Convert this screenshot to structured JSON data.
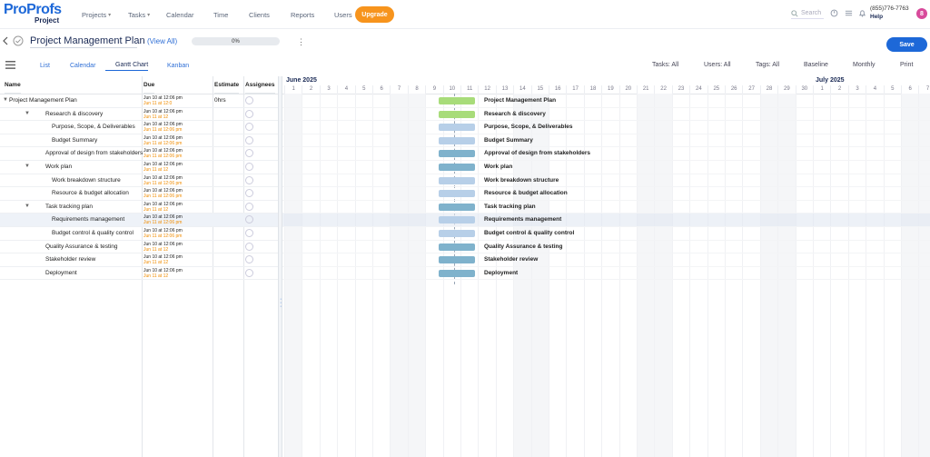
{
  "brand": {
    "name": "ProProfs",
    "product": "Project"
  },
  "nav": [
    {
      "label": "Projects",
      "icon": "folder-icon",
      "has_caret": true
    },
    {
      "label": "Tasks",
      "icon": "check-circle-icon",
      "has_caret": true
    },
    {
      "label": "Calendar",
      "icon": "calendar-icon",
      "has_caret": false
    },
    {
      "label": "Time",
      "icon": "clock-icon",
      "has_caret": false
    },
    {
      "label": "Clients",
      "icon": "client-icon",
      "has_caret": false
    },
    {
      "label": "Reports",
      "icon": "bar-chart-icon",
      "has_caret": false
    },
    {
      "label": "Users",
      "icon": "user-icon",
      "has_caret": false
    }
  ],
  "upgrade_label": "Upgrade",
  "search_placeholder": "Search",
  "phone": "(855)776-7763",
  "help_label": "Help",
  "avatar_initial": "8",
  "project": {
    "title": "Project Management Plan",
    "view_all": "(View All)",
    "progress": "0%",
    "progress_value": 0,
    "save_label": "Save"
  },
  "view_tabs": [
    {
      "label": "List",
      "icon": "list-icon",
      "active": false
    },
    {
      "label": "Calendar",
      "icon": "calendar-icon",
      "active": false
    },
    {
      "label": "Gantt Chart",
      "icon": "gantt-icon",
      "active": true
    },
    {
      "label": "Kanban",
      "icon": "kanban-icon",
      "active": false
    }
  ],
  "filters": [
    "Tasks: All",
    "Users: All",
    "Tags: All",
    "Baseline",
    "Monthly",
    "Print"
  ],
  "grid_headers": {
    "name": "Name",
    "due": "Due",
    "estimate": "Estimate",
    "assignees": "Assignees"
  },
  "tasks": [
    {
      "name": "Project Management Plan",
      "level": 0,
      "type": "project",
      "due_start": "Jun 10 at 12:06 pm",
      "due_end": "Jun 11 at 12:0",
      "estimate": "0hrs",
      "bar_color": "#a8dc7a"
    },
    {
      "name": "Research & discovery",
      "level": 1,
      "type": "folder",
      "due_start": "Jun 10 at 12:06 pm",
      "due_end": "Jun 11 at 12",
      "estimate": "",
      "bar_color": "#a8dc7a"
    },
    {
      "name": "Purpose, Scope, & Deliverables",
      "level": 2,
      "type": "doc",
      "due_start": "Jun 10 at 12:06 pm",
      "due_end": "Jun 11 at 12:06 pm",
      "estimate": "",
      "bar_color": "#b7cfe8"
    },
    {
      "name": "Budget Summary",
      "level": 2,
      "type": "doc",
      "due_start": "Jun 10 at 12:06 pm",
      "due_end": "Jun 11 at 12:06 pm",
      "estimate": "",
      "bar_color": "#b7cfe8"
    },
    {
      "name": "Approval of design from stakeholders",
      "level": 1,
      "type": "doc",
      "due_start": "Jun 10 at 12:06 pm",
      "due_end": "Jun 11 at 12:06 pm",
      "estimate": "",
      "bar_color": "#7fb2cc"
    },
    {
      "name": "Work plan",
      "level": 1,
      "type": "folder",
      "due_start": "Jun 10 at 12:06 pm",
      "due_end": "Jun 11 at 12",
      "estimate": "",
      "bar_color": "#7fb2cc"
    },
    {
      "name": "Work breakdown structure",
      "level": 2,
      "type": "doc",
      "due_start": "Jun 10 at 12:06 pm",
      "due_end": "Jun 11 at 12:06 pm",
      "estimate": "",
      "bar_color": "#b7cfe8"
    },
    {
      "name": "Resource & budget allocation",
      "level": 2,
      "type": "doc",
      "due_start": "Jun 10 at 12:06 pm",
      "due_end": "Jun 11 at 12:06 pm",
      "estimate": "",
      "bar_color": "#b7cfe8"
    },
    {
      "name": "Task tracking plan",
      "level": 1,
      "type": "folder",
      "due_start": "Jun 10 at 12:06 pm",
      "due_end": "Jun 11 at 12",
      "estimate": "",
      "bar_color": "#7fb2cc"
    },
    {
      "name": "Requirements management",
      "level": 2,
      "type": "doc",
      "due_start": "Jun 10 at 12:06 pm",
      "due_end": "Jun 11 at 12:06 pm",
      "estimate": "",
      "bar_color": "#b7cfe8",
      "selected": true
    },
    {
      "name": "Budget control & quality control",
      "level": 2,
      "type": "doc",
      "due_start": "Jun 10 at 12:06 pm",
      "due_end": "Jun 11 at 12:06 pm",
      "estimate": "",
      "bar_color": "#b7cfe8"
    },
    {
      "name": "Quality Assurance & testing",
      "level": 1,
      "type": "folder",
      "due_start": "Jun 10 at 12:06 pm",
      "due_end": "Jun 11 at 12",
      "estimate": "",
      "bar_color": "#7fb2cc"
    },
    {
      "name": "Stakeholder review",
      "level": 1,
      "type": "folder",
      "due_start": "Jun 10 at 12:06 pm",
      "due_end": "Jun 11 at 12",
      "estimate": "",
      "bar_color": "#7fb2cc"
    },
    {
      "name": "Deployment",
      "level": 1,
      "type": "folder",
      "due_start": "Jun 10 at 12:06 pm",
      "due_end": "Jun 11 at 12",
      "estimate": "",
      "bar_color": "#7fb2cc"
    }
  ],
  "timeline": {
    "months": [
      {
        "label": "June 2025"
      },
      {
        "label": "July 2025"
      }
    ],
    "days": [
      "1",
      "2",
      "3",
      "4",
      "5",
      "6",
      "7",
      "8",
      "9",
      "10",
      "11",
      "12",
      "13",
      "14",
      "15",
      "16",
      "17",
      "18",
      "19",
      "20",
      "21",
      "22",
      "23",
      "24",
      "25",
      "26",
      "27",
      "28",
      "29",
      "30",
      "1",
      "2",
      "3",
      "4",
      "5",
      "6",
      "7"
    ],
    "weekend_days": [
      1,
      7,
      8,
      14,
      15,
      21,
      22,
      28,
      29,
      36,
      37
    ],
    "today_day": 10
  }
}
